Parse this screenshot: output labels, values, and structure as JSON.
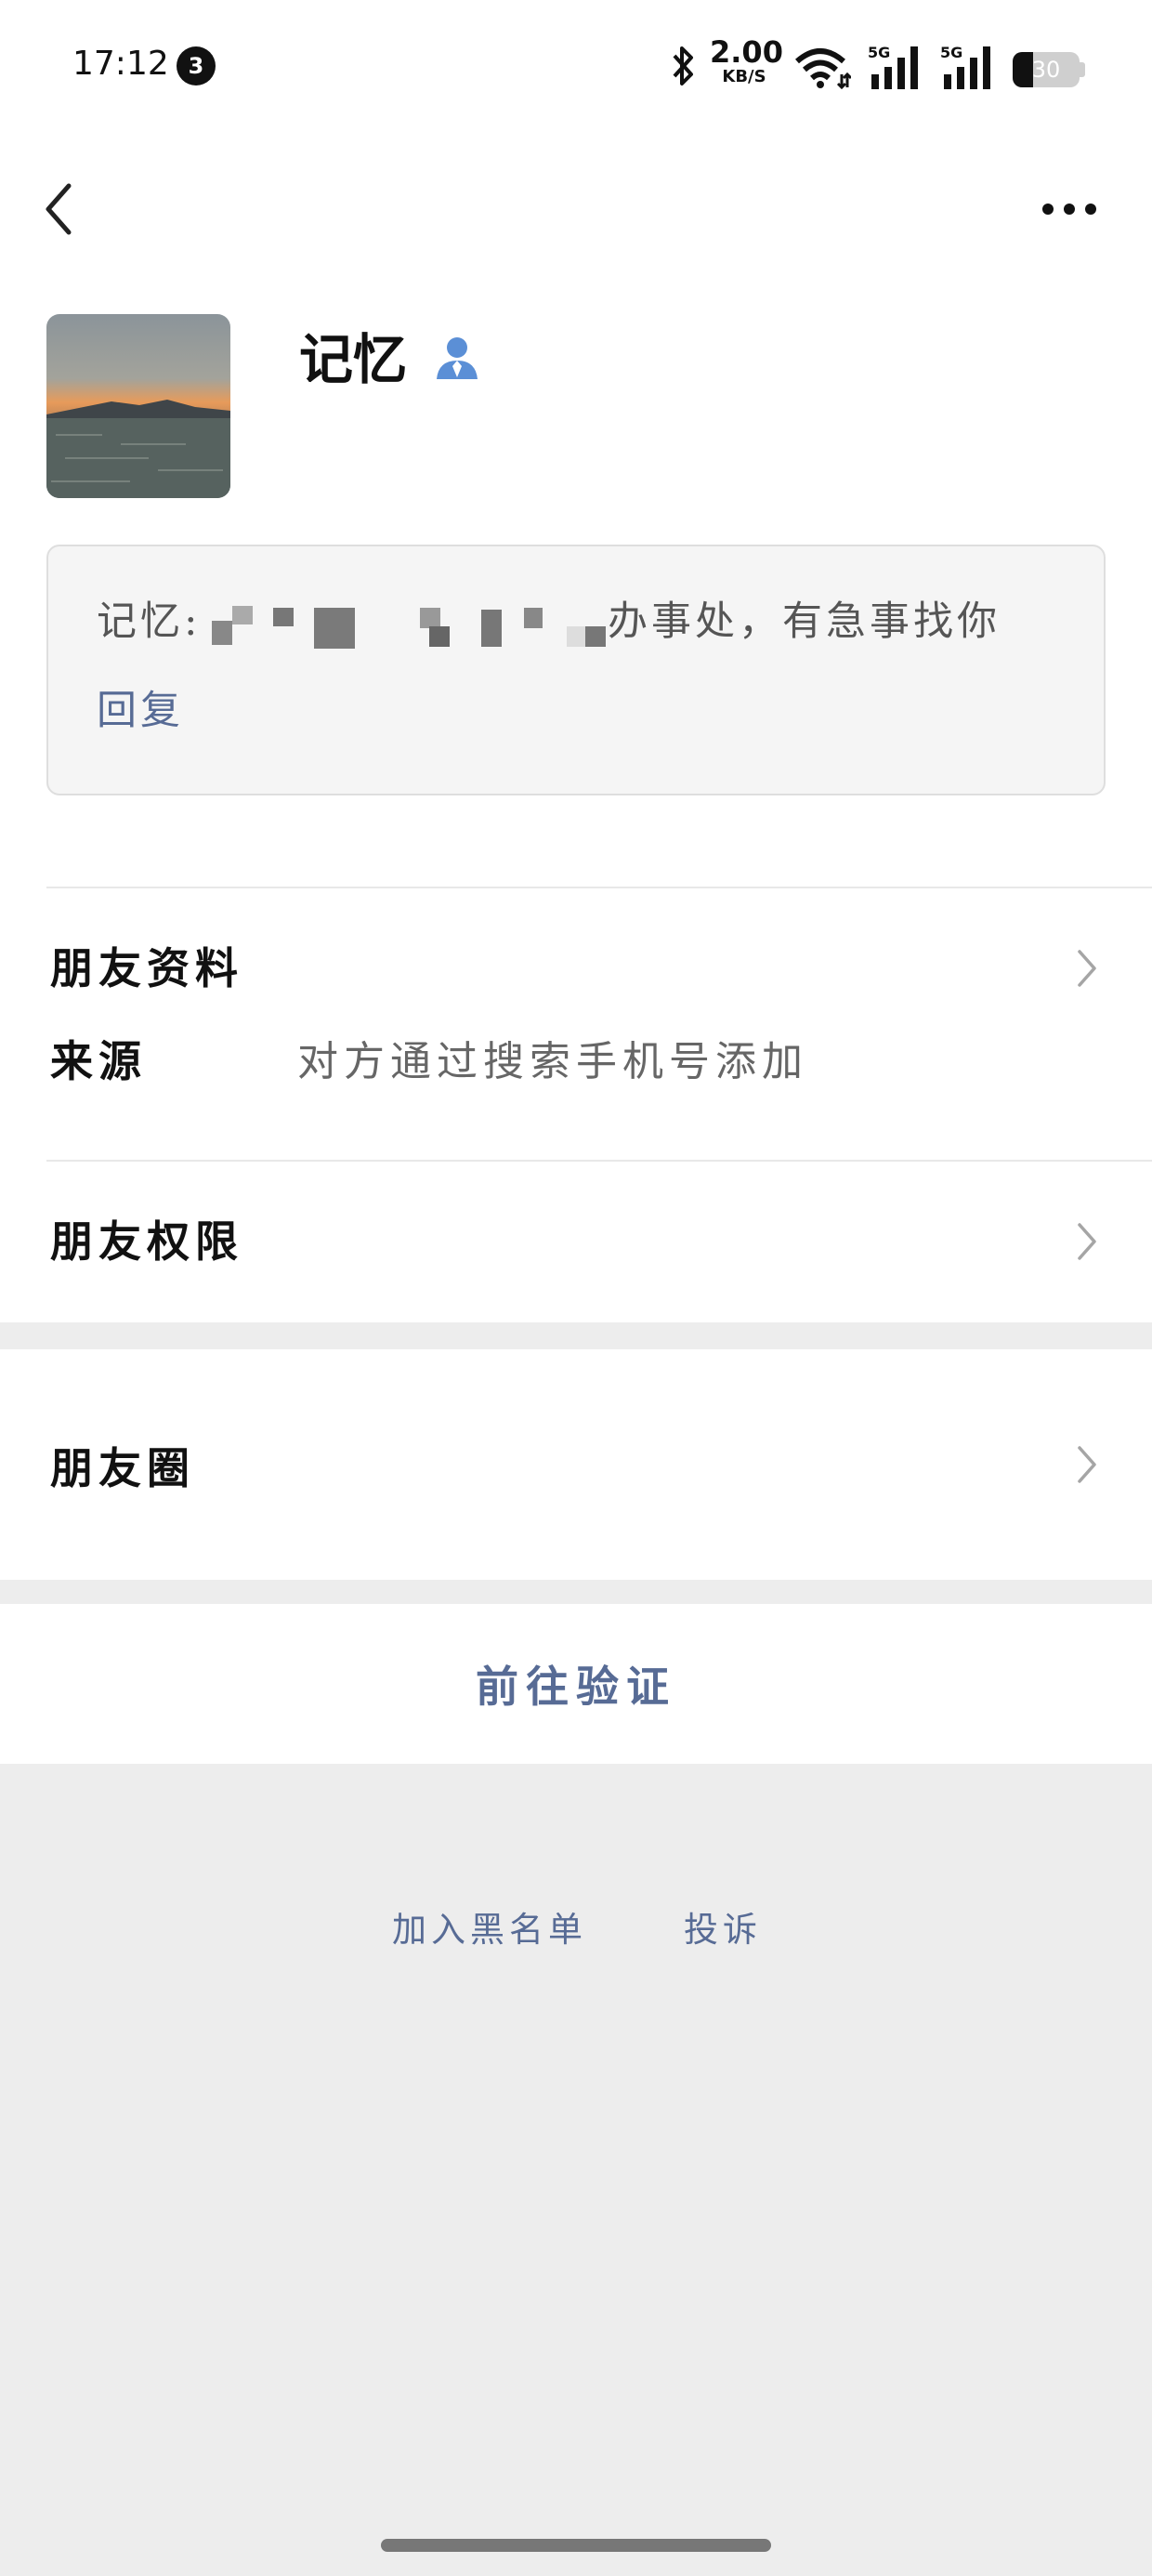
{
  "status_bar": {
    "time": "17:12",
    "notification_count": "3",
    "net_speed_value": "2.00",
    "net_speed_unit": "KB/S",
    "signal1_label": "5G",
    "signal2_label": "5G",
    "battery_level": "30",
    "icons": [
      "bluetooth-icon",
      "wifi-icon",
      "signal-icon",
      "battery-icon"
    ]
  },
  "header": {
    "back_icon": "chevron-left-icon",
    "more_icon": "more-dots-icon"
  },
  "profile": {
    "name": "记忆",
    "contact_icon": "person-icon",
    "accent_color": "#5b8fd6"
  },
  "message": {
    "prefix": "记忆:",
    "suffix": "办事处，有急事找你",
    "reply_label": "回复"
  },
  "rows": {
    "friend_info_label": "朋友资料",
    "source_label": "来源",
    "source_value": "对方通过搜索手机号添加",
    "friend_permissions_label": "朋友权限",
    "moments_label": "朋友圈"
  },
  "actions": {
    "verify_label": "前往验证",
    "blacklist_label": "加入黑名单",
    "report_label": "投诉",
    "link_color": "#576b95"
  }
}
